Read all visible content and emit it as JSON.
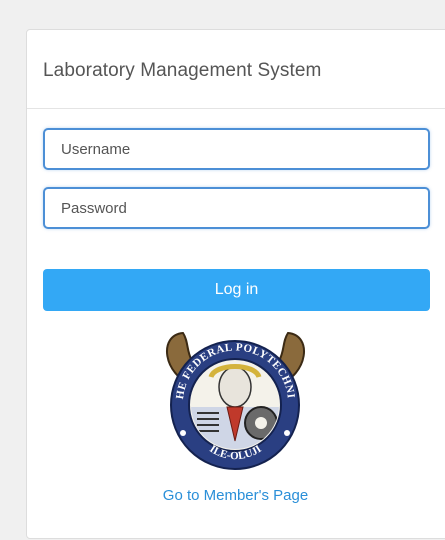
{
  "panel": {
    "title": "Laboratory Management System"
  },
  "form": {
    "username_placeholder": "Username",
    "password_placeholder": "Password",
    "login_label": "Log in"
  },
  "logo": {
    "top_text": "THE FEDERAL POLYTECHNIC",
    "bottom_text": "ILE-OLUJI"
  },
  "footer": {
    "member_link": "Go to Member's Page"
  },
  "colors": {
    "accent": "#33a8f5",
    "input_border": "#4c8fd6",
    "link": "#2a8fd8"
  }
}
